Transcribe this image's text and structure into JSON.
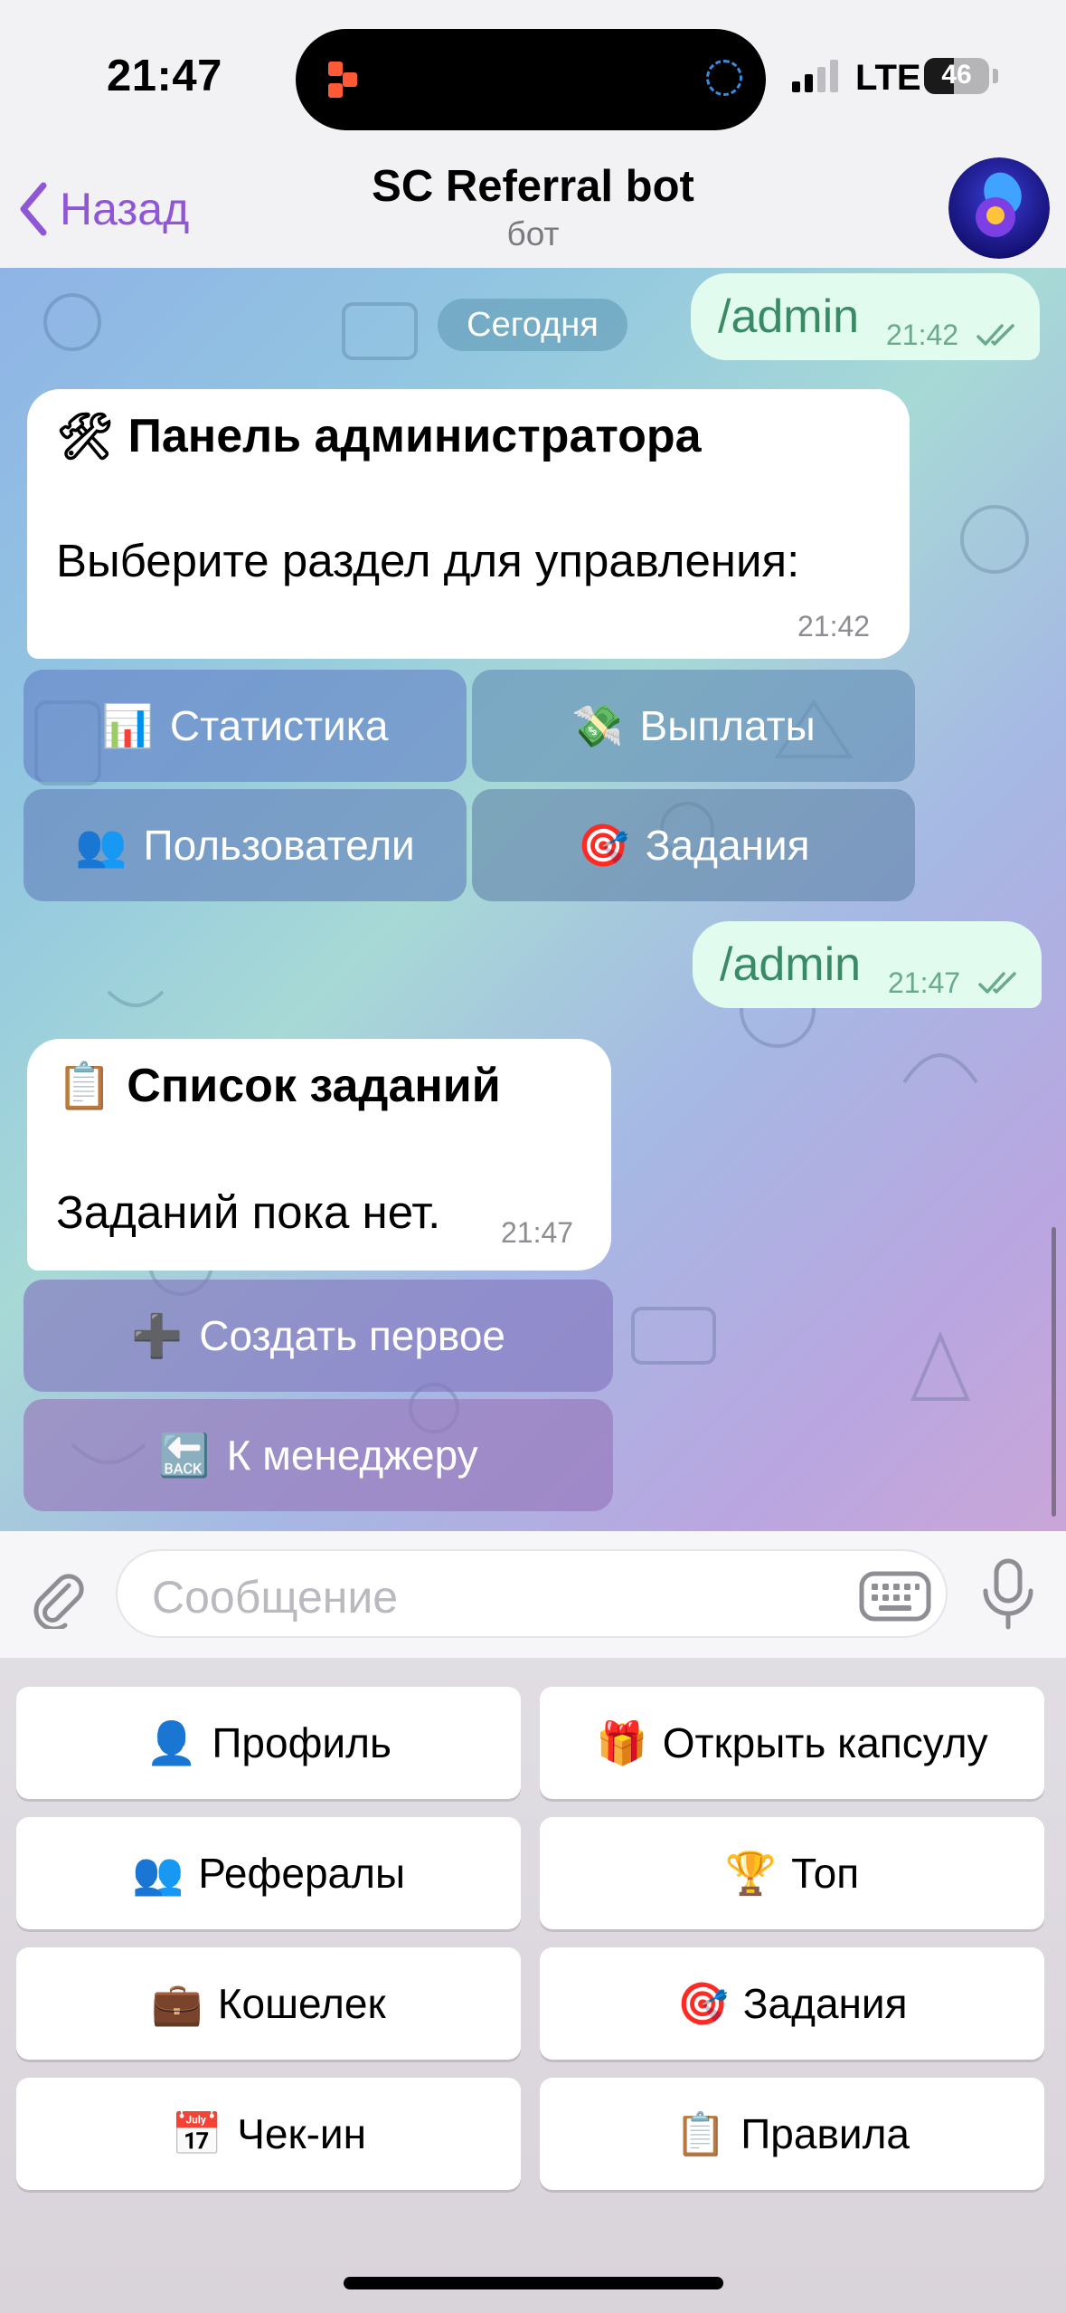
{
  "status_bar": {
    "time": "21:47",
    "network": "LTE",
    "battery": "46",
    "battery_level": 0.46
  },
  "header": {
    "back_label": "Назад",
    "title": "SC Referral bot",
    "subtitle": "бот"
  },
  "chat": {
    "date_separator": "Сегодня",
    "messages": [
      {
        "kind": "outgoing",
        "text": "/admin",
        "time": "21:42",
        "status": "read"
      },
      {
        "kind": "incoming",
        "title_emoji": "🛠",
        "title": "Панель администратора",
        "body": "Выберите раздел для управления:",
        "time": "21:42",
        "buttons": [
          {
            "emoji": "📊",
            "label": "Статистика"
          },
          {
            "emoji": "💸",
            "label": "Выплаты"
          },
          {
            "emoji": "👥",
            "label": "Пользователи"
          },
          {
            "emoji": "🎯",
            "label": "Задания"
          }
        ]
      },
      {
        "kind": "outgoing",
        "text": "/admin",
        "time": "21:47",
        "status": "read"
      },
      {
        "kind": "incoming",
        "title_emoji": "📋",
        "title": "Список заданий",
        "body": "Заданий пока нет.",
        "time": "21:47",
        "buttons": [
          {
            "emoji": "➕",
            "label": "Создать первое"
          },
          {
            "emoji": "🔙",
            "label": "К менеджеру"
          }
        ]
      }
    ]
  },
  "input": {
    "placeholder": "Сообщение"
  },
  "reply_keyboard": [
    {
      "emoji": "👤",
      "label": "Профиль"
    },
    {
      "emoji": "🎁",
      "label": "Открыть капсулу"
    },
    {
      "emoji": "👥",
      "label": "Рефералы"
    },
    {
      "emoji": "🏆",
      "label": "Топ"
    },
    {
      "emoji": "💼",
      "label": "Кошелек"
    },
    {
      "emoji": "🎯",
      "label": "Задания"
    },
    {
      "emoji": "📅",
      "label": "Чек-ин"
    },
    {
      "emoji": "📋",
      "label": "Правила"
    }
  ],
  "colors": {
    "accent": "#8f57d6",
    "outgoing_bubble": "#e1fbef",
    "outgoing_text": "#3b8a66"
  }
}
